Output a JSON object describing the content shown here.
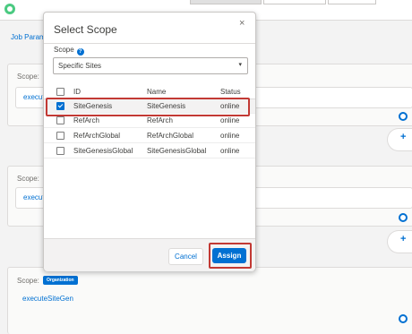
{
  "page": {
    "job_link": "Job Param",
    "cards": [
      {
        "scope_label": "Scope:",
        "input_value": "execute"
      },
      {
        "scope_label": "Scope:",
        "input_value": "execut"
      },
      {
        "scope_label": "Scope:",
        "input_value": "executeSiteGen",
        "badge": "Organization"
      }
    ],
    "plus_symbol": "+"
  },
  "modal": {
    "title": "Select Scope",
    "close_symbol": "×",
    "scope_label": "Scope",
    "help_symbol": "?",
    "select_value": "Specific Sites",
    "select_arrow": "▾",
    "columns": {
      "id": "ID",
      "name": "Name",
      "status": "Status"
    },
    "rows": [
      {
        "id": "SiteGenesis",
        "name": "SiteGenesis",
        "status": "online",
        "checked": true
      },
      {
        "id": "RefArch",
        "name": "RefArch",
        "status": "online",
        "checked": false
      },
      {
        "id": "RefArchGlobal",
        "name": "RefArchGlobal",
        "status": "online",
        "checked": false
      },
      {
        "id": "SiteGenesisGlobal",
        "name": "SiteGenesisGlobal",
        "status": "online",
        "checked": false
      }
    ],
    "cancel_label": "Cancel",
    "assign_label": "Assign"
  },
  "colors": {
    "accent": "#0070d2",
    "highlight": "#c23934",
    "logo": "#4bca81"
  }
}
